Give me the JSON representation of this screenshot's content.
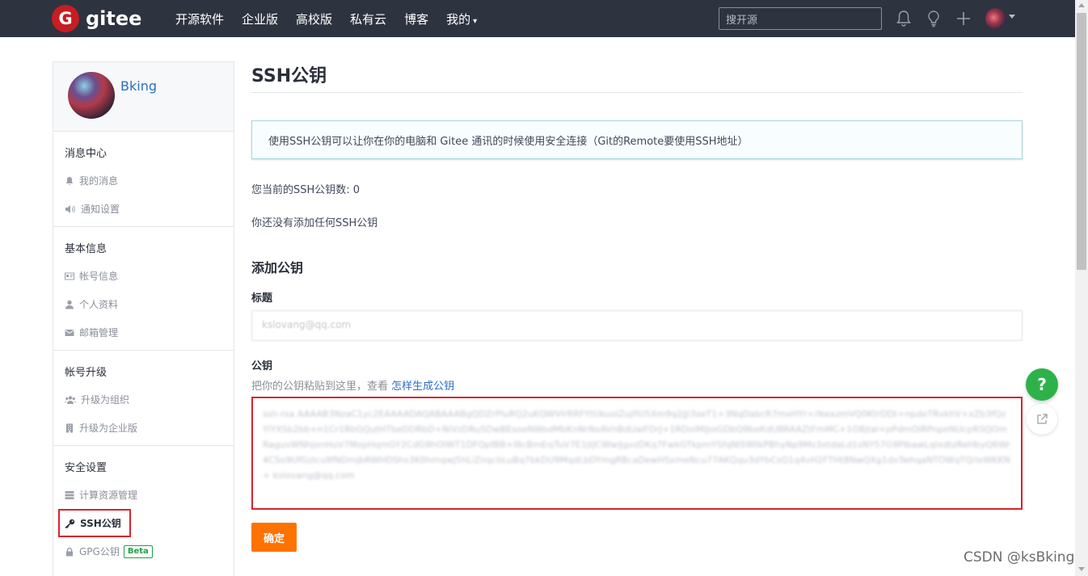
{
  "nav": {
    "logo_letter": "G",
    "logo_text": "gitee",
    "items": [
      "开源软件",
      "企业版",
      "高校版",
      "私有云",
      "博客",
      "我的"
    ],
    "search_placeholder": "搜开源",
    "icons": [
      "bell-icon",
      "lightbulb-icon",
      "plus-icon",
      "user-avatar"
    ]
  },
  "sidebar": {
    "username": "Bking",
    "sections": [
      {
        "title": "消息中心",
        "items": [
          {
            "label": "我的消息",
            "icon": "bell-icon"
          },
          {
            "label": "通知设置",
            "icon": "speaker-icon"
          }
        ]
      },
      {
        "title": "基本信息",
        "items": [
          {
            "label": "帐号信息",
            "icon": "id-card-icon"
          },
          {
            "label": "个人资料",
            "icon": "user-icon"
          },
          {
            "label": "邮箱管理",
            "icon": "envelope-icon"
          }
        ]
      },
      {
        "title": "帐号升级",
        "items": [
          {
            "label": "升级为组织",
            "icon": "group-icon"
          },
          {
            "label": "升级为企业版",
            "icon": "building-icon"
          }
        ]
      },
      {
        "title": "安全设置",
        "items": [
          {
            "label": "计算资源管理",
            "icon": "server-icon"
          },
          {
            "label": "SSH公钥",
            "icon": "key-icon",
            "active": true
          },
          {
            "label": "GPG公钥",
            "icon": "lock-icon",
            "badge": "Beta"
          }
        ]
      }
    ]
  },
  "main": {
    "title": "SSH公钥",
    "info": "使用SSH公钥可以让你在你的电脑和 Gitee 通讯的时候使用安全连接（Git的Remote要使用SSH地址）",
    "count_text": "您当前的SSH公钥数: 0",
    "none_text": "你还没有添加任何SSH公钥",
    "add_title": "添加公钥",
    "title_label": "标题",
    "title_value": "kslovang@qq.com",
    "key_label": "公钥",
    "key_hint": "把你的公钥粘贴到这里，查看",
    "key_hint_link": "怎样生成公钥",
    "key_value": "ssh-rsa AAAAB3NzaC1yc2EAAAADAQABAAABgQDZrPIuRQ2uKQWVIrRRFYtUkuoiZujfIU5Xm9q2jJi3xeT1+3NqDabcR7mxHYr+/lkexzmVQ0KtrDDt+npdeTRvkhV+xZb3fQzYiYXSb2bb+n1Cr1RbGQutHTbeDDRbD+NiVzDRu5DwBEsoeNWodMbKnNrNxAVnBdUaiFDrJ+1RDoiMlJioGDbQ9beKdU8RAAZtFmMC+1O8jtal+pPdmOlRPnpeNUcpRSQOmRaguvWNhjonHuV7MxpHqmGY2CdG9hOIWT1DFQpfBB+I8cBmEsjTuV7E1jtJCWwiJgvzDKq7FwkGTkpmYSfqNlSWtkPBhyNp9Ms3xtdaLd1sNY57G9PlbawLqIxdtzReHbyQ6Wr4CSo9UfGzIcu9fNDmjbRWHDShs3K0hmqwj5hLiZnqcbLuBq7bkDU9MqdLbDYmgRBcaDewHSxmeNcu77AKQqu3dYbCsQ1q4vH2FTHt8NwQXg1dxTwhqaNTOWqTQ/ieWKKN+ kslovang@qq.com",
    "confirm": "确定"
  },
  "floating": {
    "help": "?"
  },
  "watermark": "CSDN @ksBking",
  "colors": {
    "topbar": "#2e3340",
    "brand_red": "#c71d23",
    "link": "#2c6ec4",
    "orange": "#fe7300",
    "highlight": "#d9232d",
    "green": "#2db24a"
  }
}
